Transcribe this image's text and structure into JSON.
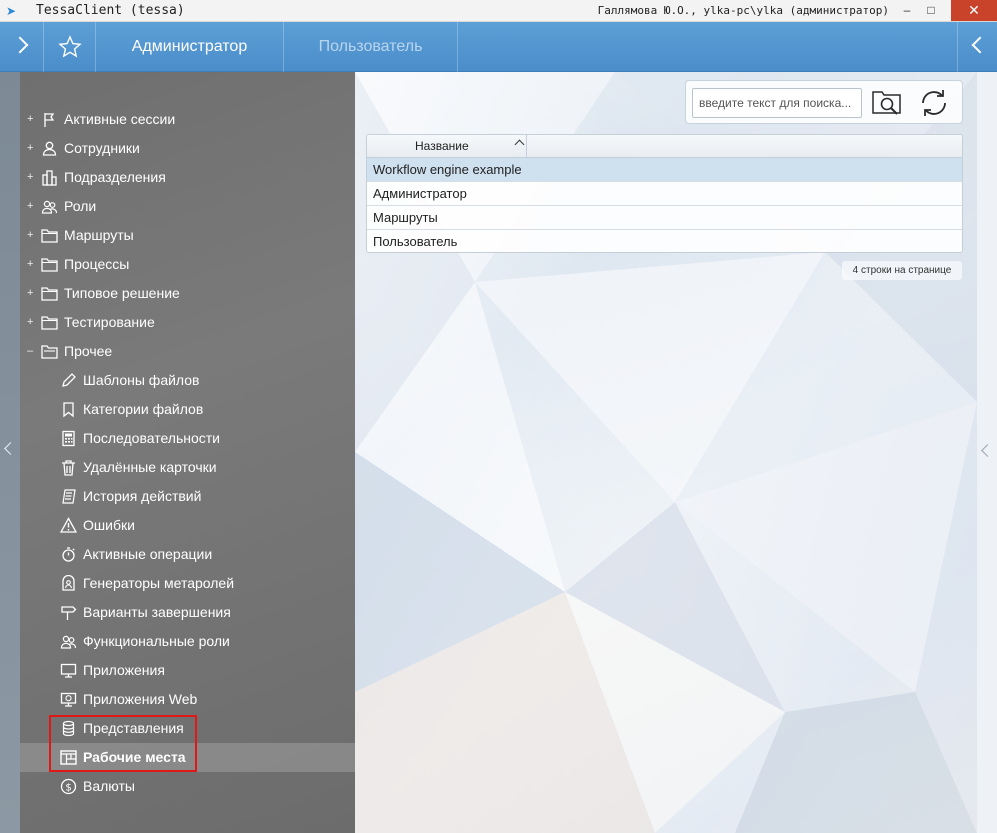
{
  "window": {
    "title": "TessaClient (tessa)",
    "user": "Галлямова Ю.О., ylka-pc\\ylka (администратор)",
    "minimize": "–",
    "maximize": "□",
    "close": "✕"
  },
  "topbar": {
    "tabs": [
      {
        "label": "Администратор",
        "active": true
      },
      {
        "label": "Пользователь",
        "active": false
      }
    ]
  },
  "sidebar": {
    "groups": [
      {
        "label": "Активные сессии",
        "toggle": "+",
        "icon": "flag-icon"
      },
      {
        "label": "Сотрудники",
        "toggle": "+",
        "icon": "person-icon"
      },
      {
        "label": "Подразделения",
        "toggle": "+",
        "icon": "building-icon"
      },
      {
        "label": "Роли",
        "toggle": "+",
        "icon": "people-icon"
      },
      {
        "label": "Маршруты",
        "toggle": "+",
        "icon": "folder-icon"
      },
      {
        "label": "Процессы",
        "toggle": "+",
        "icon": "folder-icon"
      },
      {
        "label": "Типовое решение",
        "toggle": "+",
        "icon": "folder-icon"
      },
      {
        "label": "Тестирование",
        "toggle": "+",
        "icon": "folder-icon"
      },
      {
        "label": "Прочее",
        "toggle": "–",
        "icon": "open-folder-icon"
      }
    ],
    "items": [
      {
        "label": "Шаблоны файлов",
        "icon": "pencil-icon"
      },
      {
        "label": "Категории файлов",
        "icon": "bookmark-icon"
      },
      {
        "label": "Последовательности",
        "icon": "calculator-icon"
      },
      {
        "label": "Удалённые карточки",
        "icon": "trash-icon"
      },
      {
        "label": "История действий",
        "icon": "history-icon"
      },
      {
        "label": "Ошибки",
        "icon": "warning-icon"
      },
      {
        "label": "Активные операции",
        "icon": "stopwatch-icon"
      },
      {
        "label": "Генераторы метаролей",
        "icon": "meta-role-icon"
      },
      {
        "label": "Варианты завершения",
        "icon": "signpost-icon"
      },
      {
        "label": "Функциональные роли",
        "icon": "people-icon"
      },
      {
        "label": "Приложения",
        "icon": "monitor-icon"
      },
      {
        "label": "Приложения Web",
        "icon": "web-monitor-icon"
      },
      {
        "label": "Представления",
        "icon": "database-icon"
      },
      {
        "label": "Рабочие места",
        "icon": "workplace-icon",
        "selected": true
      },
      {
        "label": "Валюты",
        "icon": "dollar-icon"
      }
    ]
  },
  "search": {
    "placeholder": "введите текст для поиска..."
  },
  "table": {
    "column": "Название",
    "rows": [
      "Workflow engine example",
      "Администратор",
      "Маршруты",
      "Пользователь"
    ]
  },
  "pager": {
    "text": "4 строки на странице"
  }
}
